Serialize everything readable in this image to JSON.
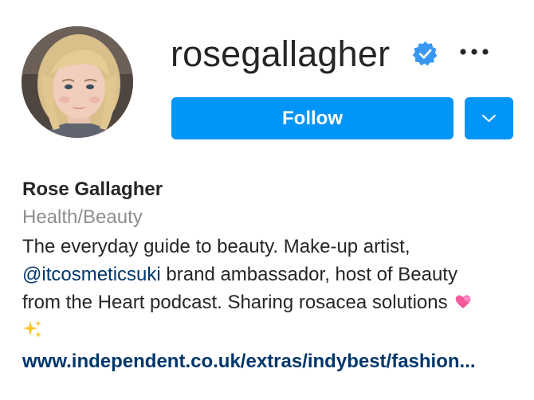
{
  "profile": {
    "username": "rosegallagher",
    "verified": true,
    "full_name": "Rose Gallagher",
    "category": "Health/Beauty",
    "bio": {
      "line1": "The everyday guide to beauty. Make-up artist,",
      "mention": "@itcosmeticsuki",
      "line2_rest": " brand ambassador, host of Beauty",
      "line3": "from the Heart podcast. Sharing rosacea solutions"
    },
    "website": "www.independent.co.uk/extras/indybest/fashion..."
  },
  "actions": {
    "follow_label": "Follow"
  },
  "icons": {
    "verified": "verified-badge-icon",
    "more": "more-options-icon",
    "dropdown": "chevron-down-icon",
    "emoji_hearts": "two-hearts-emoji",
    "emoji_sparkles": "sparkles-emoji"
  },
  "colors": {
    "primary_button": "#0095f6",
    "verified_blue": "#3897f0",
    "link": "#00376b",
    "secondary_text": "#8e8e8e",
    "text": "#262626"
  }
}
